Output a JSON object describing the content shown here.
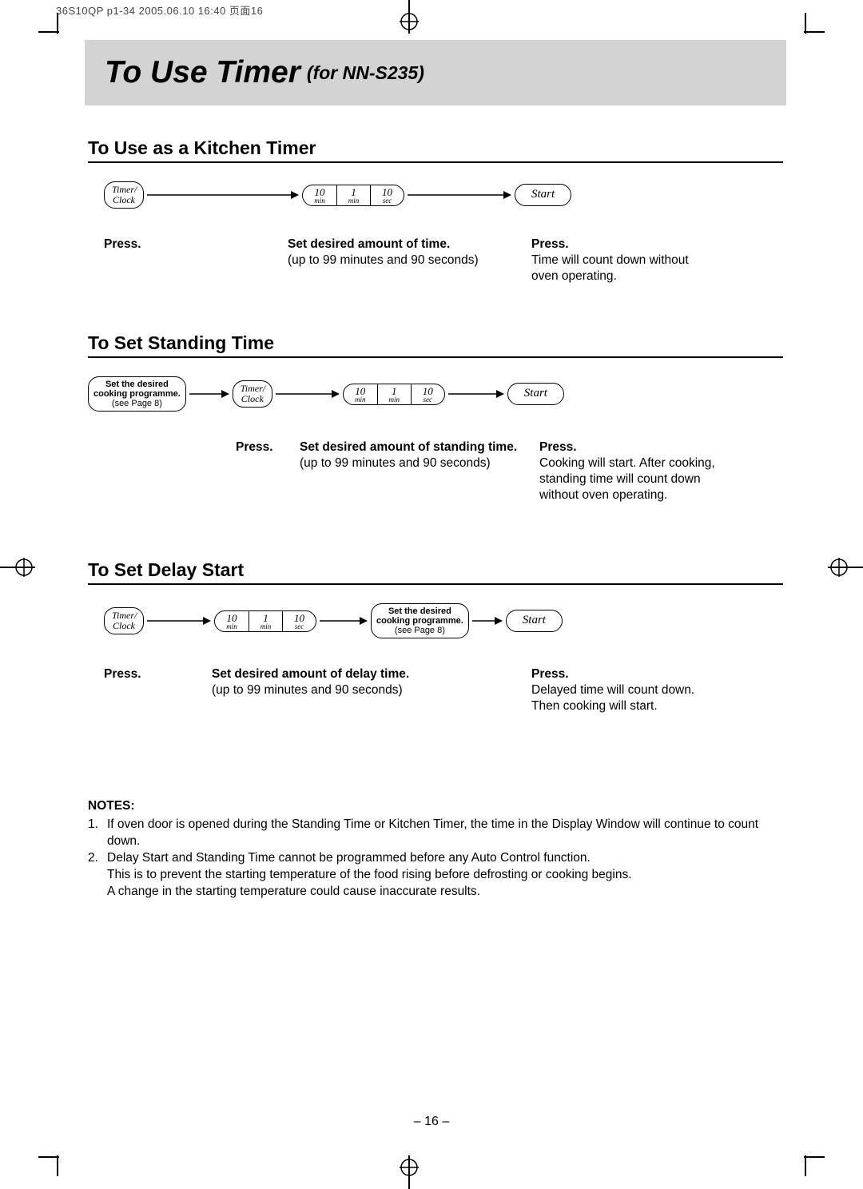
{
  "header_strip": "36S10QP p1-34  2005.06.10  16:40  页面16",
  "title_main": "To Use Timer",
  "title_sub": "(for NN-S235)",
  "section1": {
    "title": "To Use as a Kitchen Timer",
    "timer_btn": "Timer/\nClock",
    "time_cells": [
      {
        "num": "10",
        "unit": "min"
      },
      {
        "num": "1",
        "unit": "min"
      },
      {
        "num": "10",
        "unit": "sec"
      }
    ],
    "start_btn": "Start",
    "cap1": "Press.",
    "cap2b": "Set desired amount of time.",
    "cap2s": "(up to 99 minutes and 90 seconds)",
    "cap3b": "Press.",
    "cap3s": "Time will count down without oven operating."
  },
  "section2": {
    "title": "To Set Standing Time",
    "prog_b": "Set the desired\ncooking programme.",
    "prog_s": "(see Page 8)",
    "timer_btn": "Timer/\nClock",
    "time_cells": [
      {
        "num": "10",
        "unit": "min"
      },
      {
        "num": "1",
        "unit": "min"
      },
      {
        "num": "10",
        "unit": "sec"
      }
    ],
    "start_btn": "Start",
    "cap1": "Press.",
    "cap2b": "Set desired amount of standing time.",
    "cap2s": "(up to 99 minutes and 90 seconds)",
    "cap3b": "Press.",
    "cap3s": "Cooking will start. After cooking, standing time will count down without oven operating."
  },
  "section3": {
    "title": "To Set Delay Start",
    "timer_btn": "Timer/\nClock",
    "time_cells": [
      {
        "num": "10",
        "unit": "min"
      },
      {
        "num": "1",
        "unit": "min"
      },
      {
        "num": "10",
        "unit": "sec"
      }
    ],
    "prog_b": "Set the desired\ncooking programme.",
    "prog_s": "(see Page 8)",
    "start_btn": "Start",
    "cap1": "Press.",
    "cap2b": "Set desired amount of delay time.",
    "cap2s": "(up to 99 minutes and 90 seconds)",
    "cap3b": "Press.",
    "cap3s": "Delayed time will count down. Then cooking will start."
  },
  "notes": {
    "title": "NOTES:",
    "n1": "If oven door is opened during the Standing Time or Kitchen Timer, the time in the Display Window will continue to count down.",
    "n2": "Delay Start and Standing Time cannot be programmed before any Auto Control function.\nThis is to prevent the starting temperature of the food rising before defrosting or cooking begins.\nA change in the starting temperature could cause inaccurate results."
  },
  "page_number": "– 16 –"
}
